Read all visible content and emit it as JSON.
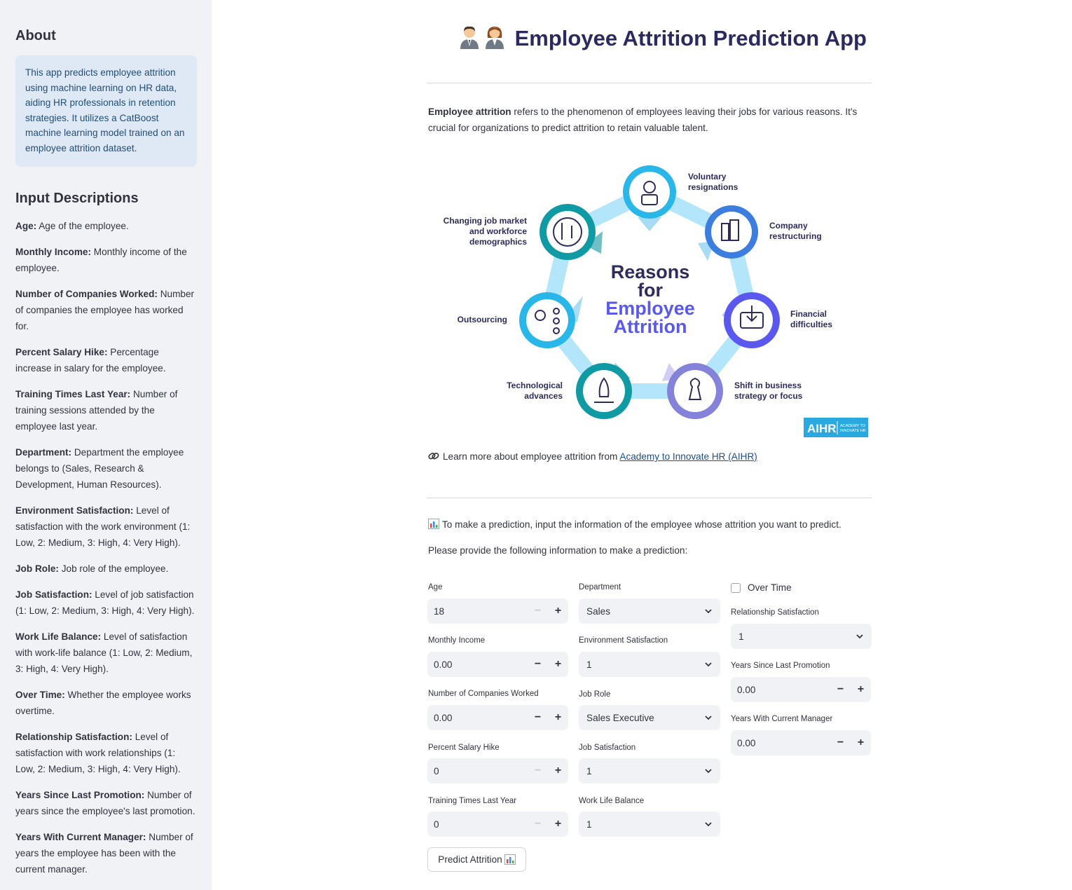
{
  "sidebar": {
    "about_heading": "About",
    "about_text": "This app predicts employee attrition using machine learning on HR data, aiding HR professionals in retention strategies. It utilizes a CatBoost machine learning model trained on an employee attrition dataset.",
    "inputs_heading": "Input Descriptions",
    "descriptions": [
      {
        "term": "Age:",
        "text": " Age of the employee."
      },
      {
        "term": "Monthly Income:",
        "text": " Monthly income of the employee."
      },
      {
        "term": "Number of Companies Worked:",
        "text": " Number of companies the employee has worked for."
      },
      {
        "term": "Percent Salary Hike:",
        "text": " Percentage increase in salary for the employee."
      },
      {
        "term": "Training Times Last Year:",
        "text": " Number of training sessions attended by the employee last year."
      },
      {
        "term": "Department:",
        "text": " Department the employee belongs to (Sales, Research & Development, Human Resources)."
      },
      {
        "term": "Environment Satisfaction:",
        "text": " Level of satisfaction with the work environment (1: Low, 2: Medium, 3: High, 4: Very High)."
      },
      {
        "term": "Job Role:",
        "text": " Job role of the employee."
      },
      {
        "term": "Job Satisfaction:",
        "text": " Level of job satisfaction (1: Low, 2: Medium, 3: High, 4: Very High)."
      },
      {
        "term": "Work Life Balance:",
        "text": " Level of satisfaction with work-life balance (1: Low, 2: Medium, 3: High, 4: Very High)."
      },
      {
        "term": "Over Time:",
        "text": " Whether the employee works overtime."
      },
      {
        "term": "Relationship Satisfaction:",
        "text": " Level of satisfaction with work relationships (1: Low, 2: Medium, 3: High, 4: Very High)."
      },
      {
        "term": "Years Since Last Promotion:",
        "text": " Number of years since the employee's last promotion."
      },
      {
        "term": "Years With Current Manager:",
        "text": " Number of years the employee has been with the current manager."
      }
    ]
  },
  "main": {
    "title": "Employee Attrition Prediction App",
    "intro_bold": "Employee attrition",
    "intro_text": " refers to the phenomenon of employees leaving their jobs for various reasons. It's crucial for organizations to predict attrition to retain valuable talent.",
    "graphic": {
      "center_line1": "Reasons",
      "center_line2": "for",
      "center_line3": "Employee",
      "center_line4": "Attrition",
      "reasons": [
        "Voluntary resignations",
        "Company restructuring",
        "Financial difficulties",
        "Shift in business strategy or focus",
        "Technological advances",
        "Outsourcing",
        "Changing job market and workforce demographics"
      ],
      "logo": "AIHR",
      "logo_sub1": "ACADEMY TO",
      "logo_sub2": "INNOVATE HR"
    },
    "learn_prefix": "Learn more about employee attrition from ",
    "learn_link": "Academy to Innovate HR (AIHR)",
    "prediction_prompt": "To make a prediction, input the information of the employee whose attrition you want to predict.",
    "provide_text": "Please provide the following information to make a prediction:",
    "predict_button": "Predict Attrition"
  },
  "form": {
    "age": {
      "label": "Age",
      "value": "18"
    },
    "monthly_income": {
      "label": "Monthly Income",
      "value": "0.00"
    },
    "num_companies": {
      "label": "Number of Companies Worked",
      "value": "0.00"
    },
    "salary_hike": {
      "label": "Percent Salary Hike",
      "value": "0"
    },
    "training_times": {
      "label": "Training Times Last Year",
      "value": "0"
    },
    "department": {
      "label": "Department",
      "value": "Sales"
    },
    "env_satisfaction": {
      "label": "Environment Satisfaction",
      "value": "1"
    },
    "job_role": {
      "label": "Job Role",
      "value": "Sales Executive"
    },
    "job_satisfaction": {
      "label": "Job Satisfaction",
      "value": "1"
    },
    "work_life_balance": {
      "label": "Work Life Balance",
      "value": "1"
    },
    "over_time": {
      "label": "Over Time",
      "checked": false
    },
    "relationship_satisfaction": {
      "label": "Relationship Satisfaction",
      "value": "1"
    },
    "years_since_promotion": {
      "label": "Years Since Last Promotion",
      "value": "0.00"
    },
    "years_with_manager": {
      "label": "Years With Current Manager",
      "value": "0.00"
    },
    "minus": "−",
    "plus": "+"
  }
}
